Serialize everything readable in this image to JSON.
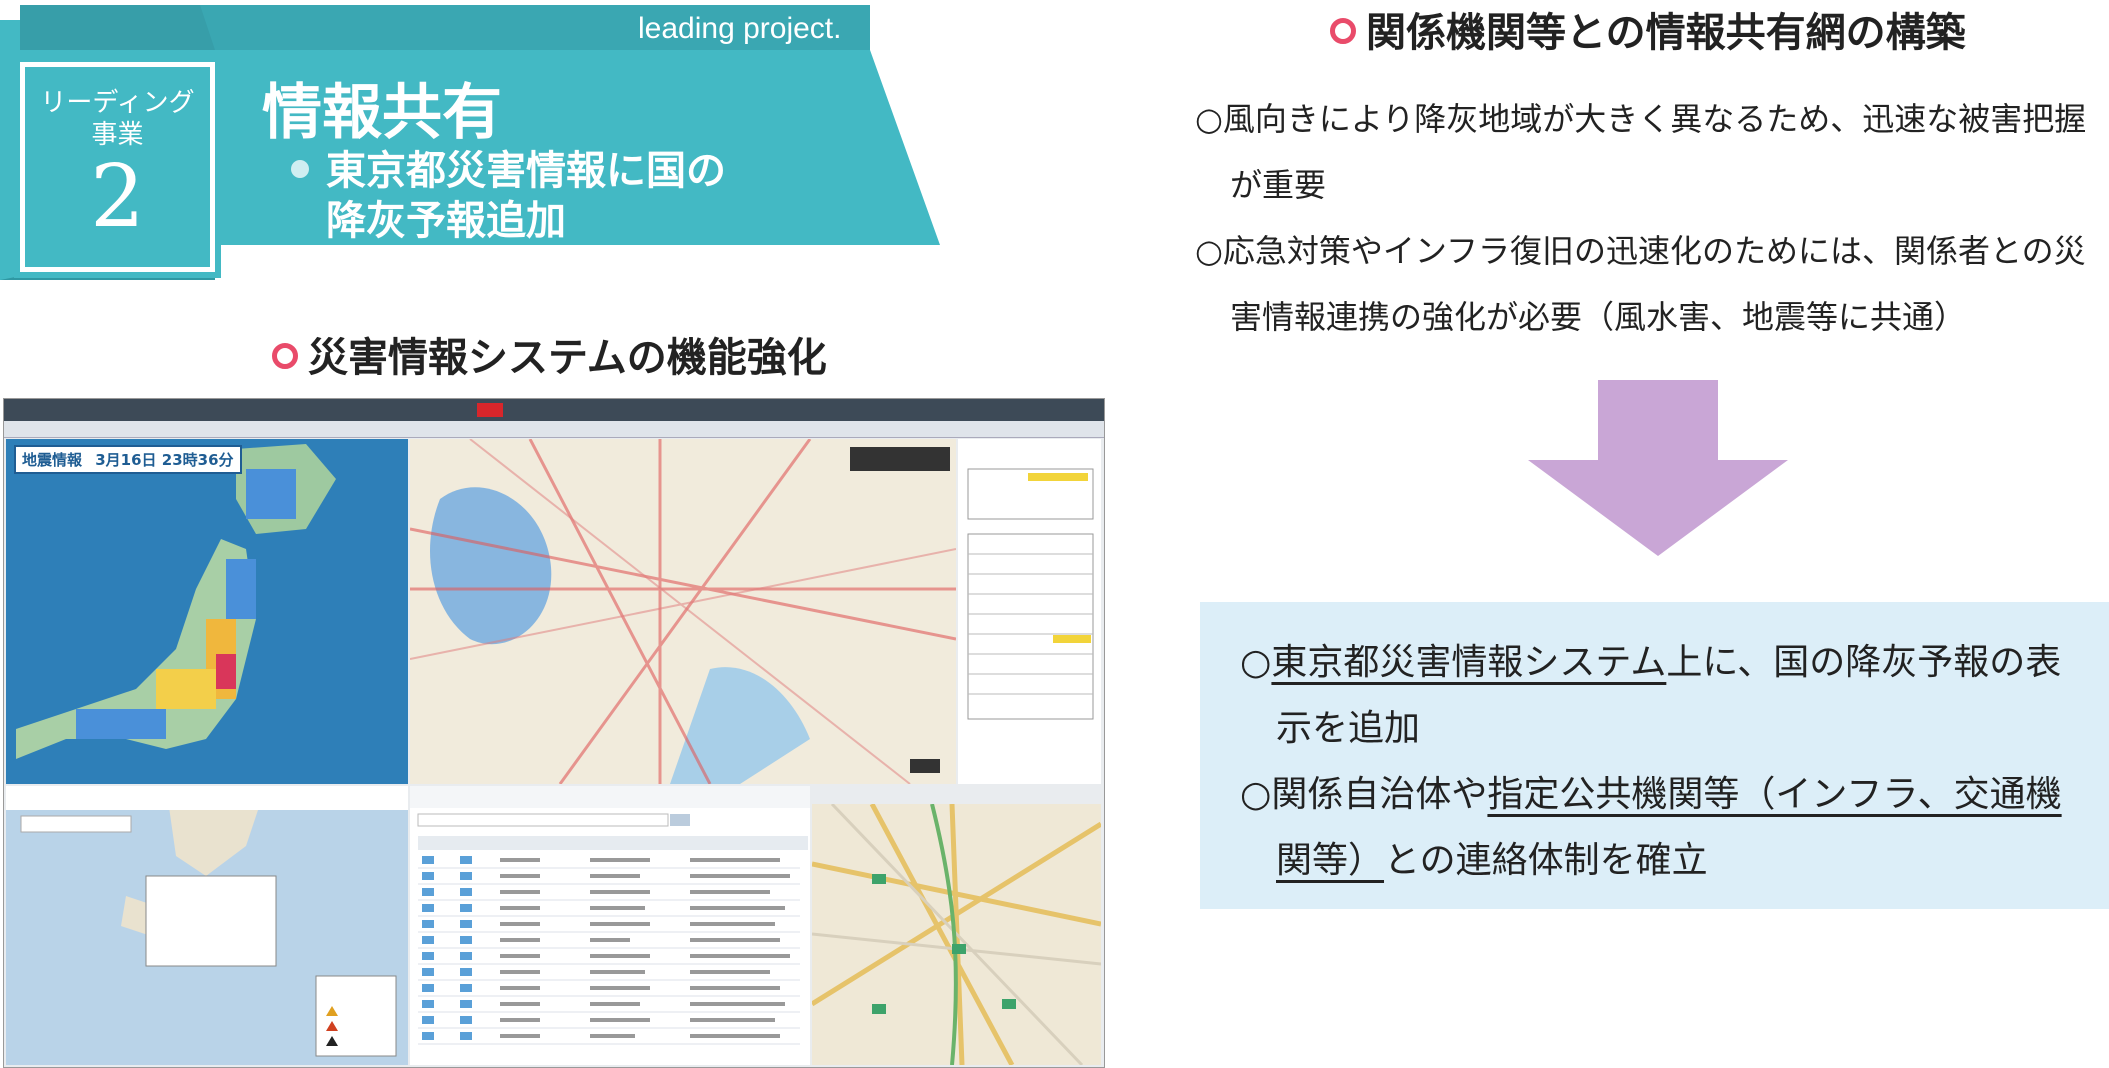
{
  "header": {
    "tagline": "leading project.",
    "badge_line1": "リーディング",
    "badge_line2": "事業",
    "badge_number": "2",
    "title": "情報共有",
    "subtitle_line1": "東京都災害情報に国の",
    "subtitle_line2": "降灰予報追加",
    "color": "#43b9c4"
  },
  "left_section": {
    "heading": "災害情報システムの機能強化",
    "screenshot": {
      "earthquake_label": "地震情報",
      "earthquake_time": "3月16日 23時36分"
    }
  },
  "right_section": {
    "heading": "関係機関等との情報共有網の構築",
    "bullet1_line1": "○風向きにより降灰地域が大きく異なるため、迅速な被害把握",
    "bullet1_line2": "が重要",
    "bullet2_line1": "○応急対策やインフラ復旧の迅速化のためには、関係者との災",
    "bullet2_line2": "害情報連携の強化が必要（風水害、地震等に共通）",
    "arrow_color": "#c9a6d6",
    "box": {
      "item1_prefix": "○",
      "item1_underlined": "東京都災害情報システム",
      "item1_rest": "上に、国の降灰予報の表",
      "item1_line2": "示を追加",
      "item2_prefix": "○関係自治体や",
      "item2_underlined": "指定公共機関等（インフラ、交通機",
      "item2_line2_underlined": "関等）",
      "item2_line2_rest": "との連絡体制を確立",
      "background": "#dceef8"
    }
  }
}
